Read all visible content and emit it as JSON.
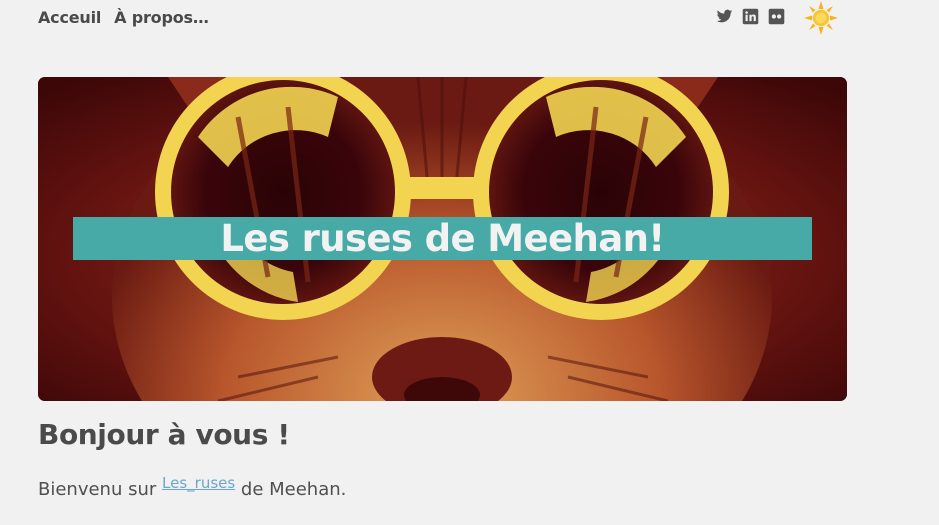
{
  "nav": {
    "items": [
      "Acceuil",
      "À propos…"
    ]
  },
  "social": {
    "icons": [
      "twitter-icon",
      "linkedin-icon",
      "flickr-icon"
    ],
    "icon_color": "#555555"
  },
  "theme_toggle": {
    "icon": "sun-icon",
    "color": "#f6b81f"
  },
  "hero": {
    "title": "Les ruses de Meehan!",
    "title_bar_color": "#47aaa7",
    "image_subject": "cat wearing round yellow sunglasses"
  },
  "post": {
    "title": "Bonjour à vous !",
    "text_before": "Bienvenu sur ",
    "link_text": "Les_ruses",
    "text_after": " de Meehan."
  }
}
